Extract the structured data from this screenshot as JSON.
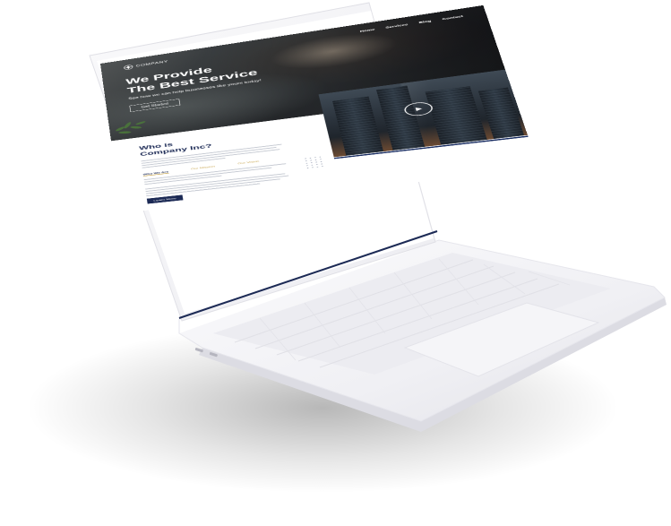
{
  "brand": {
    "logo_text": "COMPANY"
  },
  "nav": {
    "items": [
      "Home",
      "Services",
      "Blog",
      "Contact"
    ]
  },
  "hero": {
    "title_line1": "We Provide",
    "title_line2": "The Best Service",
    "subtitle": "See how we can help businesses like yours today!",
    "cta_label": "Get Started"
  },
  "about": {
    "title_line1": "Who is",
    "title_line2": "Company Inc?",
    "tabs": [
      "Who We Are",
      "Our Mission",
      "Our Vision"
    ],
    "button_label": "Learn More"
  },
  "colors": {
    "navy": "#1c2a55",
    "gold": "#c7a34a",
    "laptop_body": "#f2f2f5",
    "keyboard_key": "#f7f7f9"
  },
  "icons": [
    "logo-mark-icon",
    "play-icon",
    "plant-icon"
  ]
}
